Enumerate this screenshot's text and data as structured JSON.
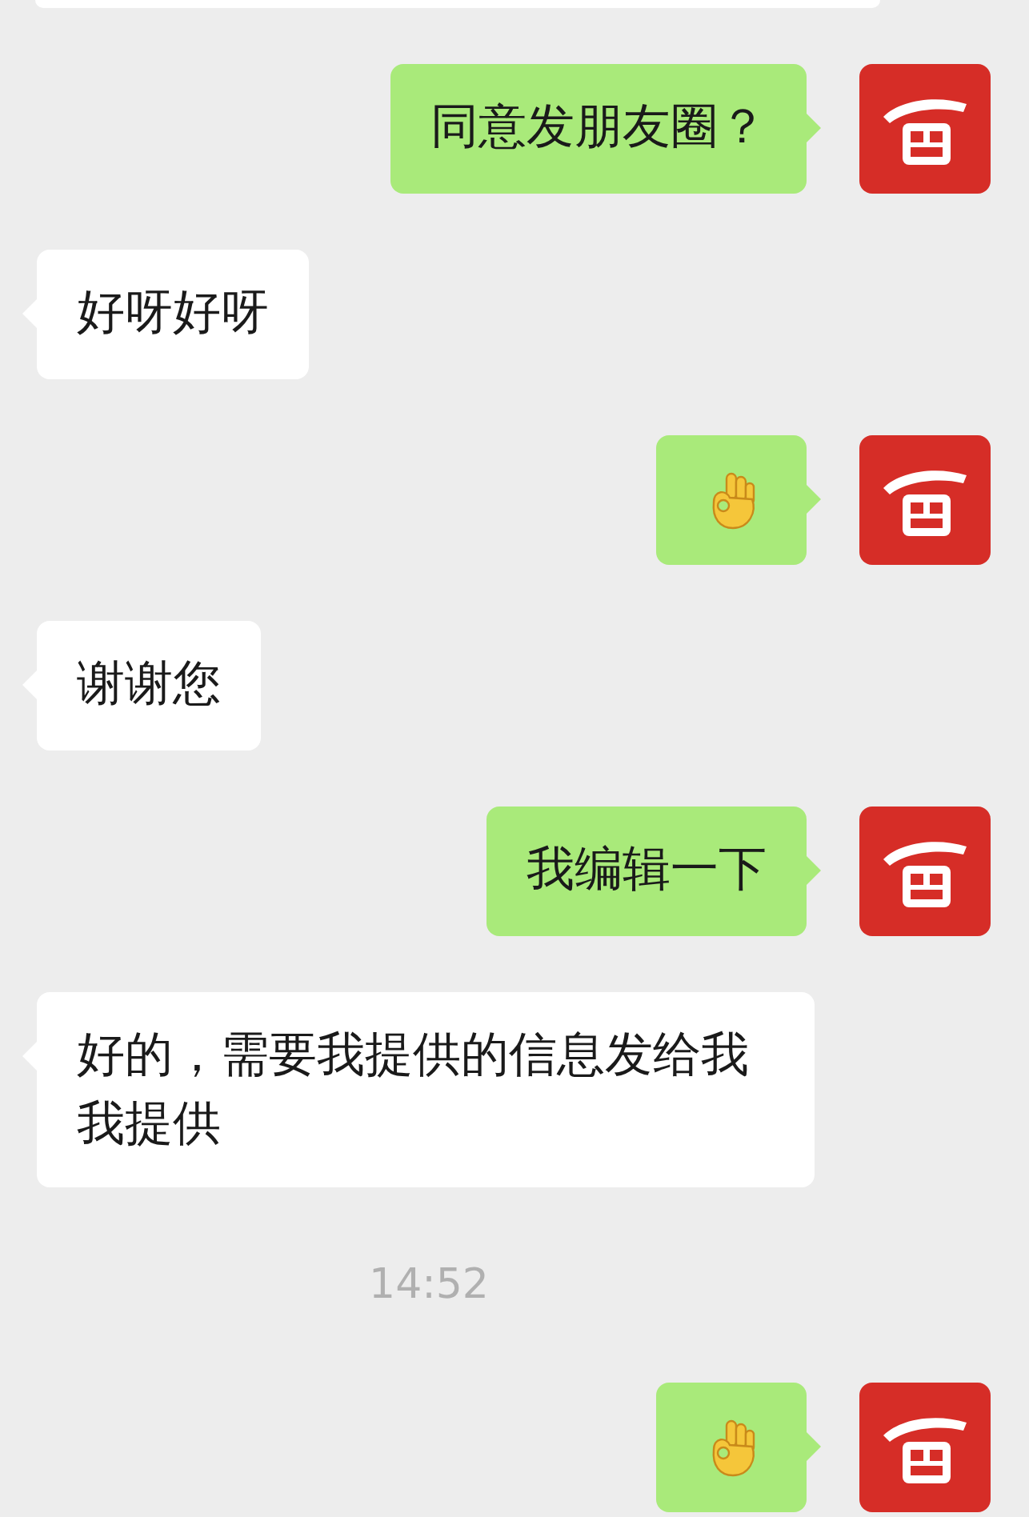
{
  "messages": [
    {
      "kind": "sent-text",
      "text": "同意发朋友圈？"
    },
    {
      "kind": "received-text",
      "text": "好呀好呀"
    },
    {
      "kind": "sent-emoji"
    },
    {
      "kind": "received-text",
      "text": "谢谢您"
    },
    {
      "kind": "sent-text",
      "text": "我编辑一下"
    },
    {
      "kind": "received-text",
      "text": "好的，需要我提供的信息发给我我提供"
    },
    {
      "kind": "timestamp",
      "text": "14:52"
    },
    {
      "kind": "sent-emoji"
    }
  ]
}
